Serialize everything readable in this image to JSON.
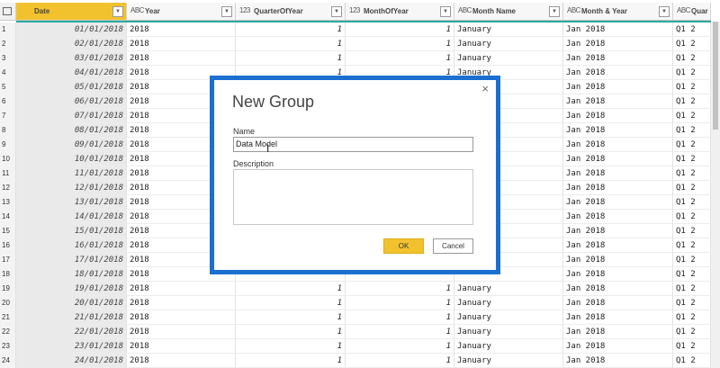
{
  "table": {
    "columns": [
      {
        "name": "Date",
        "type": "calendar-grid-icon"
      },
      {
        "name": "Year",
        "type": "ABC"
      },
      {
        "name": "QuarterOfYear",
        "type": "123"
      },
      {
        "name": "MonthOfYear",
        "type": "123"
      },
      {
        "name": "Month Name",
        "type": "ABC"
      },
      {
        "name": "Month & Year",
        "type": "ABC"
      },
      {
        "name": "Quar",
        "type": "ABC"
      }
    ],
    "rows": [
      {
        "n": "1",
        "date": "01/01/2018",
        "year": "2018",
        "q": "1",
        "m": "1",
        "mname": "January",
        "my": "Jan 2018",
        "qt": "Q1 2"
      },
      {
        "n": "2",
        "date": "02/01/2018",
        "year": "2018",
        "q": "1",
        "m": "1",
        "mname": "January",
        "my": "Jan 2018",
        "qt": "Q1 2"
      },
      {
        "n": "3",
        "date": "03/01/2018",
        "year": "2018",
        "q": "1",
        "m": "1",
        "mname": "January",
        "my": "Jan 2018",
        "qt": "Q1 2"
      },
      {
        "n": "4",
        "date": "04/01/2018",
        "year": "2018",
        "q": "1",
        "m": "1",
        "mname": "January",
        "my": "Jan 2018",
        "qt": "Q1 2"
      },
      {
        "n": "5",
        "date": "05/01/2018",
        "year": "2018",
        "q": "",
        "m": "",
        "mname": "",
        "my": "Jan 2018",
        "qt": "Q1 2"
      },
      {
        "n": "6",
        "date": "06/01/2018",
        "year": "2018",
        "q": "",
        "m": "",
        "mname": "",
        "my": "Jan 2018",
        "qt": "Q1 2"
      },
      {
        "n": "7",
        "date": "07/01/2018",
        "year": "2018",
        "q": "",
        "m": "",
        "mname": "",
        "my": "Jan 2018",
        "qt": "Q1 2"
      },
      {
        "n": "8",
        "date": "08/01/2018",
        "year": "2018",
        "q": "",
        "m": "",
        "mname": "",
        "my": "Jan 2018",
        "qt": "Q1 2"
      },
      {
        "n": "9",
        "date": "09/01/2018",
        "year": "2018",
        "q": "",
        "m": "",
        "mname": "",
        "my": "Jan 2018",
        "qt": "Q1 2"
      },
      {
        "n": "10",
        "date": "10/01/2018",
        "year": "2018",
        "q": "",
        "m": "",
        "mname": "",
        "my": "Jan 2018",
        "qt": "Q1 2"
      },
      {
        "n": "11",
        "date": "11/01/2018",
        "year": "2018",
        "q": "",
        "m": "",
        "mname": "",
        "my": "Jan 2018",
        "qt": "Q1 2"
      },
      {
        "n": "12",
        "date": "12/01/2018",
        "year": "2018",
        "q": "",
        "m": "",
        "mname": "",
        "my": "Jan 2018",
        "qt": "Q1 2"
      },
      {
        "n": "13",
        "date": "13/01/2018",
        "year": "2018",
        "q": "",
        "m": "",
        "mname": "",
        "my": "Jan 2018",
        "qt": "Q1 2"
      },
      {
        "n": "14",
        "date": "14/01/2018",
        "year": "2018",
        "q": "",
        "m": "",
        "mname": "",
        "my": "Jan 2018",
        "qt": "Q1 2"
      },
      {
        "n": "15",
        "date": "15/01/2018",
        "year": "2018",
        "q": "",
        "m": "",
        "mname": "",
        "my": "Jan 2018",
        "qt": "Q1 2"
      },
      {
        "n": "16",
        "date": "16/01/2018",
        "year": "2018",
        "q": "",
        "m": "",
        "mname": "",
        "my": "Jan 2018",
        "qt": "Q1 2"
      },
      {
        "n": "17",
        "date": "17/01/2018",
        "year": "2018",
        "q": "",
        "m": "",
        "mname": "",
        "my": "Jan 2018",
        "qt": "Q1 2"
      },
      {
        "n": "18",
        "date": "18/01/2018",
        "year": "2018",
        "q": "",
        "m": "",
        "mname": "",
        "my": "Jan 2018",
        "qt": "Q1 2"
      },
      {
        "n": "19",
        "date": "19/01/2018",
        "year": "2018",
        "q": "1",
        "m": "1",
        "mname": "January",
        "my": "Jan 2018",
        "qt": "Q1 2"
      },
      {
        "n": "20",
        "date": "20/01/2018",
        "year": "2018",
        "q": "1",
        "m": "1",
        "mname": "January",
        "my": "Jan 2018",
        "qt": "Q1 2"
      },
      {
        "n": "21",
        "date": "21/01/2018",
        "year": "2018",
        "q": "1",
        "m": "1",
        "mname": "January",
        "my": "Jan 2018",
        "qt": "Q1 2"
      },
      {
        "n": "22",
        "date": "22/01/2018",
        "year": "2018",
        "q": "1",
        "m": "1",
        "mname": "January",
        "my": "Jan 2018",
        "qt": "Q1 2"
      },
      {
        "n": "23",
        "date": "23/01/2018",
        "year": "2018",
        "q": "1",
        "m": "1",
        "mname": "January",
        "my": "Jan 2018",
        "qt": "Q1 2"
      },
      {
        "n": "24",
        "date": "24/01/2018",
        "year": "2018",
        "q": "1",
        "m": "1",
        "mname": "January",
        "my": "Jan 2018",
        "qt": "Q1 2"
      }
    ]
  },
  "dialog": {
    "title": "New Group",
    "close_glyph": "×",
    "name_label": "Name",
    "name_value": "Data Model",
    "description_label": "Description",
    "description_value": "",
    "ok_label": "OK",
    "cancel_label": "Cancel"
  },
  "colors": {
    "accent": "#f2c22e",
    "highlight_border": "#1b6fd1",
    "header_rule": "#2aa8a0"
  }
}
